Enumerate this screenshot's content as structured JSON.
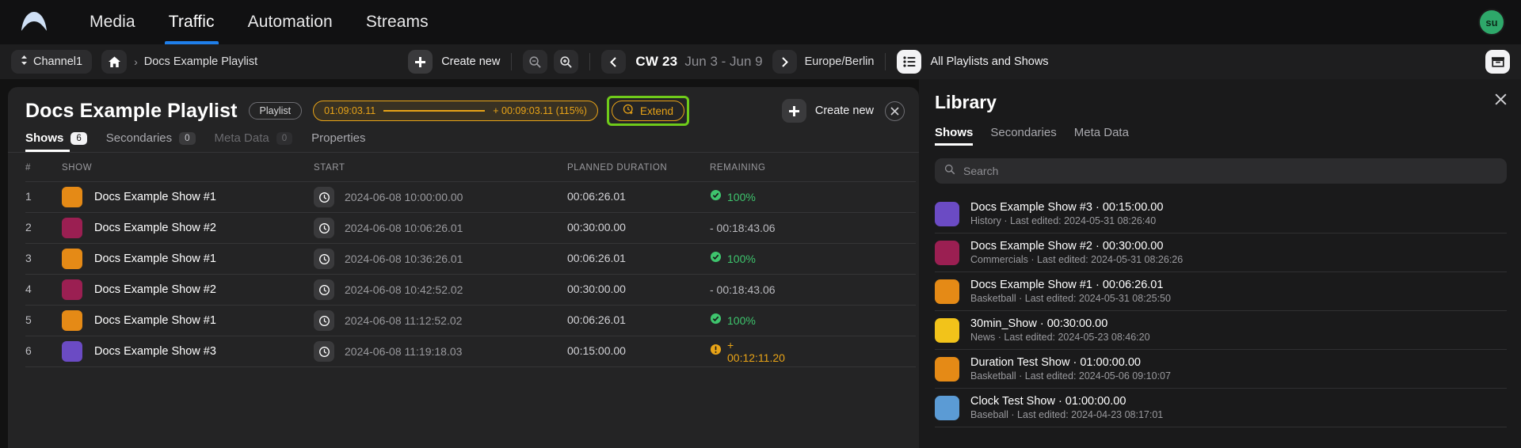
{
  "topnav": {
    "logo_icon": "app-logo-icon",
    "items": [
      {
        "label": "Media",
        "active": false
      },
      {
        "label": "Traffic",
        "active": true
      },
      {
        "label": "Automation",
        "active": false
      },
      {
        "label": "Streams",
        "active": false
      }
    ],
    "avatar_initials": "su",
    "avatar_color": "#2ea86a",
    "accent_color": "#1f7fea"
  },
  "toolbar": {
    "channel_label": "Channel1",
    "channel_icon": "updown-chevrons-icon",
    "home_icon": "home-icon",
    "breadcrumb_separator": "›",
    "breadcrumb_label": "Docs Example Playlist",
    "create_new_label": "Create new",
    "create_new_icon": "plus-icon",
    "zoom_out_icon": "zoom-out-icon",
    "zoom_in_icon": "zoom-in-icon",
    "prev_icon": "chevron-left-icon",
    "next_icon": "chevron-right-icon",
    "calendar_week": "CW 23",
    "date_range": "Jun 3 - Jun 9",
    "timezone": "Europe/Berlin",
    "all_playlists_label": "All Playlists and Shows",
    "list_icon": "list-icon",
    "right_icon": "inbox-archive-icon"
  },
  "playlist": {
    "title": "Docs Example Playlist",
    "type_tag": "Playlist",
    "duration_badge": {
      "total": "01:09:03.11",
      "delta": "+ 00:09:03.11 (115%)",
      "color": "#e8a317"
    },
    "extend_label": "Extend",
    "extend_icon": "clock-plus-icon",
    "extend_focus_color": "#6fcb1a",
    "create_new_label": "Create new",
    "create_new_icon": "plus-icon",
    "close_icon": "close-icon",
    "tabs": [
      {
        "label": "Shows",
        "count": "6",
        "active": true,
        "dim": false
      },
      {
        "label": "Secondaries",
        "count": "0",
        "active": false,
        "dim": false
      },
      {
        "label": "Meta Data",
        "count": "0",
        "active": false,
        "dim": true
      },
      {
        "label": "Properties",
        "count": "",
        "active": false,
        "dim": false
      }
    ]
  },
  "table": {
    "columns": [
      "#",
      "SHOW",
      "START",
      "PLANNED DURATION",
      "REMAINING"
    ],
    "clock_icon": "clock-icon",
    "rows": [
      {
        "num": "1",
        "show": "Docs Example Show #1",
        "color": "#e58a16",
        "start": "2024-06-08 10:00:00.00",
        "duration": "00:06:26.01",
        "remaining": "100%",
        "state": "ok",
        "icon": "check-circle-icon",
        "bar_pct": 100,
        "bar_color": "#3ec46d"
      },
      {
        "num": "2",
        "show": "Docs Example Show #2",
        "color": "#9b1f52",
        "start": "2024-06-08 10:06:26.01",
        "duration": "00:30:00.00",
        "remaining": "- 00:18:43.06",
        "state": "neu",
        "icon": "",
        "bar_pct": 62,
        "bar_color": "#d8d8da"
      },
      {
        "num": "3",
        "show": "Docs Example Show #1",
        "color": "#e58a16",
        "start": "2024-06-08 10:36:26.01",
        "duration": "00:06:26.01",
        "remaining": "100%",
        "state": "ok",
        "icon": "check-circle-icon",
        "bar_pct": 100,
        "bar_color": "#3ec46d"
      },
      {
        "num": "4",
        "show": "Docs Example Show #2",
        "color": "#9b1f52",
        "start": "2024-06-08 10:42:52.02",
        "duration": "00:30:00.00",
        "remaining": "- 00:18:43.06",
        "state": "neu",
        "icon": "",
        "bar_pct": 62,
        "bar_color": "#d8d8da"
      },
      {
        "num": "5",
        "show": "Docs Example Show #1",
        "color": "#e58a16",
        "start": "2024-06-08 11:12:52.02",
        "duration": "00:06:26.01",
        "remaining": "100%",
        "state": "ok",
        "icon": "check-circle-icon",
        "bar_pct": 100,
        "bar_color": "#3ec46d"
      },
      {
        "num": "6",
        "show": "Docs Example Show #3",
        "color": "#6b4bc4",
        "start": "2024-06-08 11:19:18.03",
        "duration": "00:15:00.00",
        "remaining": "+ 00:12:11.20",
        "state": "warn",
        "icon": "warning-circle-icon",
        "bar_pct": 100,
        "bar_color": "#e8a317"
      }
    ]
  },
  "library": {
    "title": "Library",
    "close_icon": "close-icon",
    "tabs": [
      {
        "label": "Shows",
        "active": true
      },
      {
        "label": "Secondaries",
        "active": false
      },
      {
        "label": "Meta Data",
        "active": false
      }
    ],
    "search_placeholder": "Search",
    "search_value": "",
    "search_icon": "search-icon",
    "items": [
      {
        "name": "Docs Example Show #3 · 00:15:00.00",
        "meta": "History · Last edited: 2024-05-31 08:26:40",
        "color": "#6b4bc4"
      },
      {
        "name": "Docs Example Show #2 · 00:30:00.00",
        "meta": "Commercials · Last edited: 2024-05-31 08:26:26",
        "color": "#9b1f52"
      },
      {
        "name": "Docs Example Show #1 · 00:06:26.01",
        "meta": "Basketball · Last edited: 2024-05-31 08:25:50",
        "color": "#e58a16"
      },
      {
        "name": "30min_Show · 00:30:00.00",
        "meta": "News · Last edited: 2024-05-23 08:46:20",
        "color": "#f2c31a"
      },
      {
        "name": "Duration Test Show · 01:00:00.00",
        "meta": "Basketball · Last edited: 2024-05-06 09:10:07",
        "color": "#e58a16"
      },
      {
        "name": "Clock Test Show · 01:00:00.00",
        "meta": "Baseball · Last edited: 2024-04-23 08:17:01",
        "color": "#5b9bd5"
      }
    ]
  }
}
